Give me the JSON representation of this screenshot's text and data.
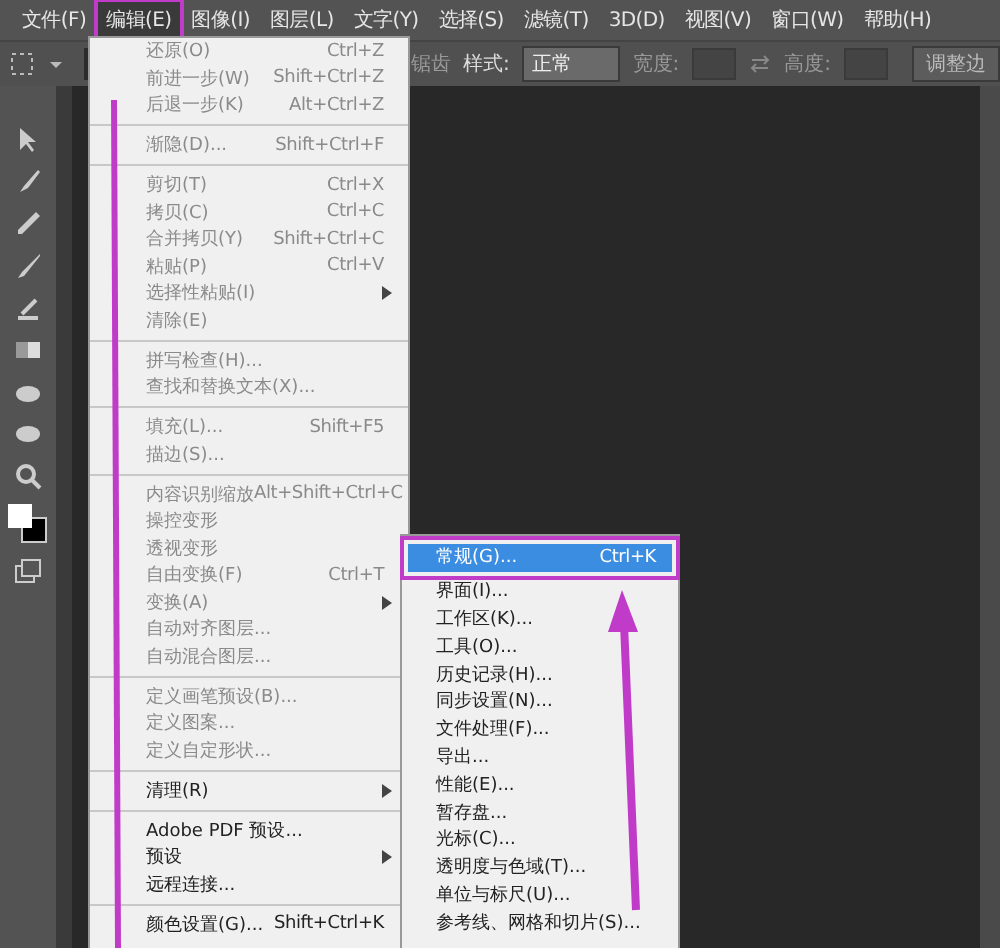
{
  "menubar": [
    {
      "label": "文件(F)",
      "selected": false
    },
    {
      "label": "编辑(E)",
      "selected": true
    },
    {
      "label": "图像(I)",
      "selected": false
    },
    {
      "label": "图层(L)",
      "selected": false
    },
    {
      "label": "文字(Y)",
      "selected": false
    },
    {
      "label": "选择(S)",
      "selected": false
    },
    {
      "label": "滤镜(T)",
      "selected": false
    },
    {
      "label": "3D(D)",
      "selected": false
    },
    {
      "label": "视图(V)",
      "selected": false
    },
    {
      "label": "窗口(W)",
      "selected": false
    },
    {
      "label": "帮助(H)",
      "selected": false
    }
  ],
  "options_bar": {
    "antialias_label": "锯齿",
    "style_label": "样式:",
    "style_value": "正常",
    "width_label": "宽度:",
    "height_label": "高度:",
    "refine_button": "调整边"
  },
  "edit_menu": [
    {
      "kind": "item",
      "label": "还原(O)",
      "shortcut": "Ctrl+Z",
      "disabled": true,
      "submenu": false
    },
    {
      "kind": "item",
      "label": "前进一步(W)",
      "shortcut": "Shift+Ctrl+Z",
      "disabled": true,
      "submenu": false
    },
    {
      "kind": "item",
      "label": "后退一步(K)",
      "shortcut": "Alt+Ctrl+Z",
      "disabled": true,
      "submenu": false
    },
    {
      "kind": "separator"
    },
    {
      "kind": "item",
      "label": "渐隐(D)...",
      "shortcut": "Shift+Ctrl+F",
      "disabled": true,
      "submenu": false
    },
    {
      "kind": "separator"
    },
    {
      "kind": "item",
      "label": "剪切(T)",
      "shortcut": "Ctrl+X",
      "disabled": true,
      "submenu": false
    },
    {
      "kind": "item",
      "label": "拷贝(C)",
      "shortcut": "Ctrl+C",
      "disabled": true,
      "submenu": false
    },
    {
      "kind": "item",
      "label": "合并拷贝(Y)",
      "shortcut": "Shift+Ctrl+C",
      "disabled": true,
      "submenu": false
    },
    {
      "kind": "item",
      "label": "粘贴(P)",
      "shortcut": "Ctrl+V",
      "disabled": true,
      "submenu": false
    },
    {
      "kind": "item",
      "label": "选择性粘贴(I)",
      "disabled": true,
      "submenu": true
    },
    {
      "kind": "item",
      "label": "清除(E)",
      "disabled": true,
      "submenu": false
    },
    {
      "kind": "separator"
    },
    {
      "kind": "item",
      "label": "拼写检查(H)...",
      "disabled": true,
      "submenu": false
    },
    {
      "kind": "item",
      "label": "查找和替换文本(X)...",
      "disabled": true,
      "submenu": false
    },
    {
      "kind": "separator"
    },
    {
      "kind": "item",
      "label": "填充(L)...",
      "shortcut": "Shift+F5",
      "disabled": true,
      "submenu": false
    },
    {
      "kind": "item",
      "label": "描边(S)...",
      "disabled": true,
      "submenu": false
    },
    {
      "kind": "separator"
    },
    {
      "kind": "item",
      "label": "内容识别缩放",
      "shortcut": "Alt+Shift+Ctrl+C",
      "disabled": true,
      "submenu": false
    },
    {
      "kind": "item",
      "label": "操控变形",
      "disabled": true,
      "submenu": false
    },
    {
      "kind": "item",
      "label": "透视变形",
      "disabled": true,
      "submenu": false
    },
    {
      "kind": "item",
      "label": "自由变换(F)",
      "shortcut": "Ctrl+T",
      "disabled": true,
      "submenu": false
    },
    {
      "kind": "item",
      "label": "变换(A)",
      "disabled": true,
      "submenu": true
    },
    {
      "kind": "item",
      "label": "自动对齐图层...",
      "disabled": true,
      "submenu": false
    },
    {
      "kind": "item",
      "label": "自动混合图层...",
      "disabled": true,
      "submenu": false
    },
    {
      "kind": "separator"
    },
    {
      "kind": "item",
      "label": "定义画笔预设(B)...",
      "disabled": true,
      "submenu": false
    },
    {
      "kind": "item",
      "label": "定义图案...",
      "disabled": true,
      "submenu": false
    },
    {
      "kind": "item",
      "label": "定义自定形状...",
      "disabled": true,
      "submenu": false
    },
    {
      "kind": "separator"
    },
    {
      "kind": "item",
      "label": "清理(R)",
      "disabled": false,
      "submenu": true
    },
    {
      "kind": "separator"
    },
    {
      "kind": "item",
      "label": "Adobe PDF 预设...",
      "disabled": false,
      "submenu": false
    },
    {
      "kind": "item",
      "label": "预设",
      "disabled": false,
      "submenu": true
    },
    {
      "kind": "item",
      "label": "远程连接...",
      "disabled": false,
      "submenu": false
    },
    {
      "kind": "separator"
    },
    {
      "kind": "item",
      "label": "颜色设置(G)...",
      "shortcut": "Shift+Ctrl+K",
      "disabled": false,
      "submenu": false
    }
  ],
  "preferences_submenu": [
    {
      "label": "常规(G)...",
      "shortcut": "Ctrl+K",
      "selected": true
    },
    {
      "label": "界面(I)...",
      "selected": false
    },
    {
      "label": "工作区(K)...",
      "selected": false
    },
    {
      "label": "工具(O)...",
      "selected": false
    },
    {
      "label": "历史记录(H)...",
      "selected": false
    },
    {
      "label": "同步设置(N)...",
      "selected": false
    },
    {
      "label": "文件处理(F)...",
      "selected": false
    },
    {
      "label": "导出...",
      "selected": false
    },
    {
      "label": "性能(E)...",
      "selected": false
    },
    {
      "label": "暂存盘...",
      "selected": false
    },
    {
      "label": "光标(C)...",
      "selected": false
    },
    {
      "label": "透明度与色域(T)...",
      "selected": false
    },
    {
      "label": "单位与标尺(U)...",
      "selected": false
    },
    {
      "label": "参考线、网格和切片(S)...",
      "selected": false
    }
  ]
}
